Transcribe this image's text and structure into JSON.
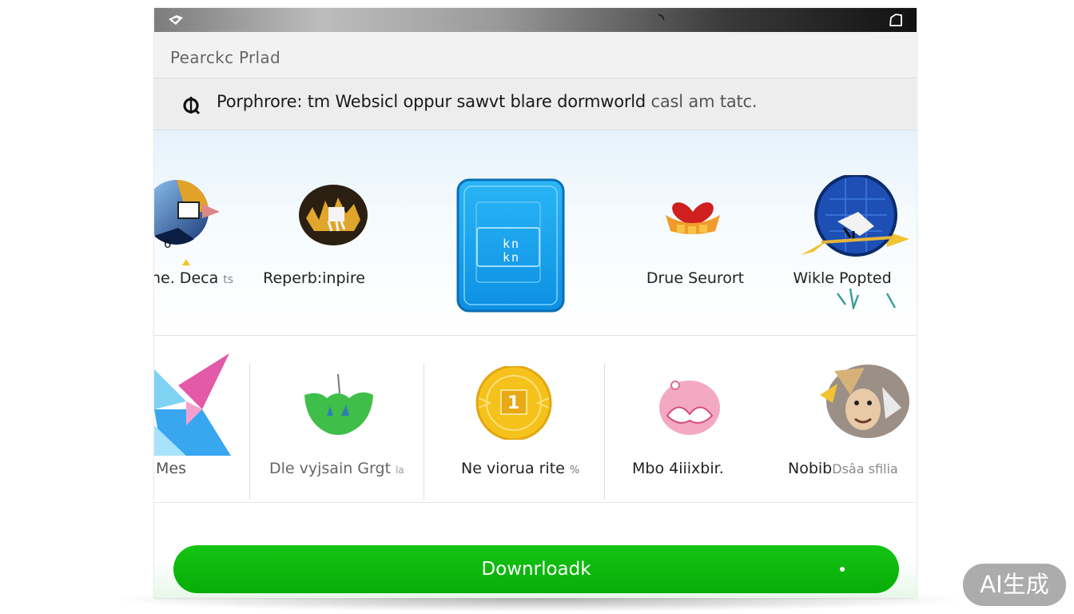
{
  "search": {
    "text": "Pearckc Prlad"
  },
  "info_bar": {
    "text": "Porphrore: tm Websicl oppur sawvt blare dormworld",
    "text_muted": "casl am tatc."
  },
  "row1": [
    {
      "label": "ne. Deca",
      "label_small": "ts",
      "icon": "globe-collage-icon",
      "badge": "0"
    },
    {
      "label": "Reperb:inpire",
      "icon": "gold-circle-app-icon"
    },
    {
      "label": "",
      "icon": "blue-tablet-icon",
      "glyph_text": "kn kn",
      "selected": true
    },
    {
      "label": "Drue Seurort",
      "icon": "heart-food-icon"
    },
    {
      "label": "Wikle Popted",
      "icon": "blue-globe-icon"
    }
  ],
  "row2": [
    {
      "label": "Mes",
      "icon": "pink-blue-geometric-icon"
    },
    {
      "label": "Dle vyjsain Grgt",
      "label_small": "la",
      "icon": "green-bowl-icon"
    },
    {
      "label": "Ne viorua rite",
      "label_small": "%",
      "icon": "gold-coin-icon",
      "glyph_text": "1"
    },
    {
      "label": "Mbo 4iiixbir.",
      "icon": "pink-ring-icon"
    },
    {
      "label": "Nobib",
      "label_small": "Dsâa sfilia",
      "icon": "cartoon-face-icon"
    }
  ],
  "download": {
    "label": "Downrloadk"
  },
  "badge": {
    "label": "AI生成"
  },
  "colors": {
    "download": "#0cb80c",
    "titlebar_dark": "#111111",
    "accent_blue": "#1ea7f0"
  }
}
